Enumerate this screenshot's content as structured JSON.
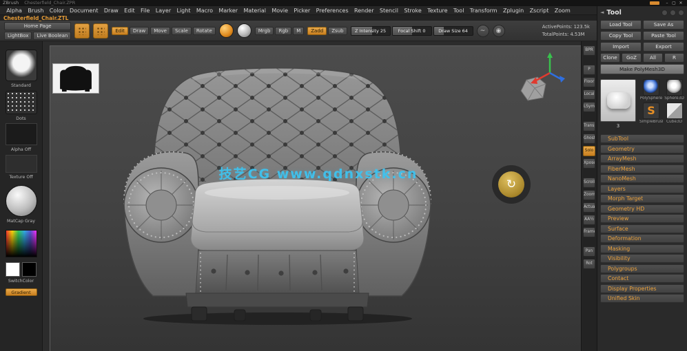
{
  "window": {
    "title": "ZBrush",
    "document_name": "Chesterfield_Chair.ZPR",
    "controls": {
      "minimize": "–",
      "maximize": "▢",
      "close": "✕"
    }
  },
  "menu_bar": [
    "Alpha",
    "Brush",
    "Color",
    "Document",
    "Draw",
    "Edit",
    "File",
    "Layer",
    "Light",
    "Macro",
    "Marker",
    "Material",
    "Movie",
    "Picker",
    "Preferences",
    "Render",
    "Stencil",
    "Stroke",
    "Texture",
    "Tool",
    "Transform",
    "Zplugin",
    "Zscript",
    "Zoom"
  ],
  "hint_text": "Chesterfield_Chair.ZTL",
  "shelf": {
    "home_page": "Home Page",
    "lightbox": "LightBox",
    "live_boolean": "Live Boolean",
    "icon_names": [
      "quicksketch-dots-icon",
      "spotlight-dots-icon",
      "color-orb-icon",
      "material-orb-icon",
      "lazy-mouse-curve-icon",
      "pen-pressure-icon"
    ],
    "mode_buttons": [
      {
        "label": "Edit",
        "active": true
      },
      {
        "label": "Draw",
        "active": false
      },
      {
        "label": "Move",
        "active": false
      },
      {
        "label": "Scale",
        "active": false
      },
      {
        "label": "Rotate",
        "active": false
      }
    ],
    "paint_buttons": [
      {
        "label": "Mrgb",
        "active": false
      },
      {
        "label": "Rgb",
        "active": false
      },
      {
        "label": "M",
        "active": false
      }
    ],
    "sculpt_buttons": [
      {
        "label": "Zadd",
        "active": true
      },
      {
        "label": "Zsub",
        "active": false
      }
    ],
    "sliders": [
      {
        "label": "Z Intensity",
        "value": "25",
        "fill": 55
      },
      {
        "label": "Focal Shift",
        "value": "0",
        "fill": 50
      },
      {
        "label": "Draw Size",
        "value": "64",
        "fill": 25
      }
    ],
    "stats": [
      "ActivePoints: 123.5k",
      "TotalPoints: 4.53M"
    ]
  },
  "left_tray": {
    "brush_label": "Standard",
    "stroke_label": "Dots",
    "alpha_label": "Alpha Off",
    "texture_label": "Texture Off",
    "material_label": "MatCap Gray",
    "switch_label": "SwitchColor",
    "gradient_label": "Gradient"
  },
  "canvas": {
    "watermark": "技艺CG  www.qdnxstk.cn"
  },
  "right_shelf": [
    [
      {
        "label": "BPR",
        "active": false
      }
    ],
    [
      {
        "label": "P",
        "active": false
      },
      {
        "label": "Floor",
        "active": false
      },
      {
        "label": "Local",
        "active": false
      },
      {
        "label": "LSym",
        "active": false
      }
    ],
    [
      {
        "label": "Transp",
        "active": false
      },
      {
        "label": "Ghost",
        "active": false
      },
      {
        "label": "Solo",
        "active": true
      },
      {
        "label": "Xpose",
        "active": false
      }
    ],
    [
      {
        "label": "Scroll",
        "active": false
      },
      {
        "label": "Zoom",
        "active": false
      },
      {
        "label": "Actual",
        "active": false
      },
      {
        "label": "AA½",
        "active": false
      },
      {
        "label": "Frame",
        "active": false
      }
    ],
    [
      {
        "label": "Pan",
        "active": false
      },
      {
        "label": "Rot",
        "active": false
      }
    ]
  ],
  "tool_palette": {
    "title": "Tool",
    "button_rows": [
      [
        "Load Tool",
        "Save As"
      ],
      [
        "Copy Tool",
        "Paste Tool"
      ],
      [
        "Import",
        "Export"
      ],
      [
        "Clone",
        "GoZ",
        "All",
        "R"
      ]
    ],
    "wide_button": "Make PolyMesh3D",
    "preview_value": "3",
    "recent_tools": [
      {
        "label": "PolySphere",
        "icon": "sphere-blue",
        "glyph": ""
      },
      {
        "label": "Sphere3D",
        "icon": "sphere-white",
        "glyph": ""
      },
      {
        "label": "SimpleBrush",
        "icon": "s-curve",
        "glyph": "S"
      },
      {
        "label": "Cube3D",
        "icon": "cube",
        "glyph": ""
      }
    ],
    "subpalettes": [
      "SubTool",
      "Geometry",
      "ArrayMesh",
      "FiberMesh",
      "NanoMesh",
      "Layers",
      "Morph Target",
      "Geometry HD",
      "Preview",
      "Surface",
      "Deformation",
      "Masking",
      "Visibility",
      "Polygroups",
      "Contact",
      "Display Properties",
      "Unified Skin"
    ]
  }
}
